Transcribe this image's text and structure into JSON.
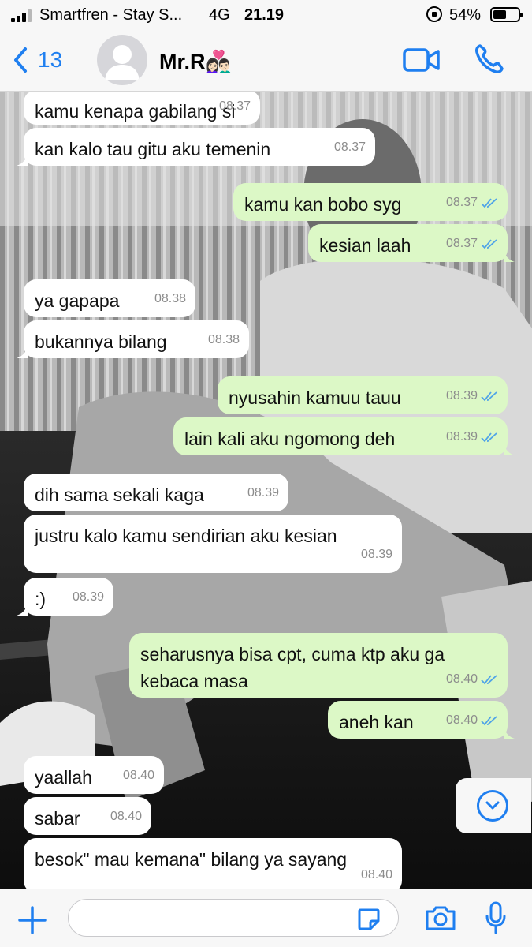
{
  "status_bar": {
    "carrier": "Smartfren - Stay S...",
    "network": "4G",
    "time": "21.19",
    "battery_percent": "54%",
    "battery_level": 0.54,
    "signal_bars": 3
  },
  "header": {
    "back_count": "13",
    "contact_name": "Mr.R👩🏻‍❤️‍👨🏻",
    "icons": [
      "chevron-left-icon",
      "video-call-icon",
      "phone-icon"
    ]
  },
  "messages": [
    {
      "dir": "in",
      "text": "kamu kenapa gabilang si",
      "time": "08.37"
    },
    {
      "dir": "in",
      "text": "kan kalo tau gitu aku temenin",
      "time": "08.37"
    },
    {
      "dir": "out",
      "text": "kamu kan bobo syg",
      "time": "08.37"
    },
    {
      "dir": "out",
      "text": "kesian laah",
      "time": "08.37"
    },
    {
      "dir": "in",
      "text": "ya gapapa",
      "time": "08.38"
    },
    {
      "dir": "in",
      "text": "bukannya bilang",
      "time": "08.38"
    },
    {
      "dir": "out",
      "text": "nyusahin kamuu tauu",
      "time": "08.39"
    },
    {
      "dir": "out",
      "text": "lain kali aku ngomong deh",
      "time": "08.39"
    },
    {
      "dir": "in",
      "text": "dih sama sekali kaga",
      "time": "08.39"
    },
    {
      "dir": "in",
      "text": "justru kalo kamu sendirian aku kesian",
      "time": "08.39"
    },
    {
      "dir": "in",
      "text": ":)",
      "time": "08.39"
    },
    {
      "dir": "out",
      "text": "seharusnya bisa cpt, cuma ktp aku ga kebaca masa",
      "time": "08.40"
    },
    {
      "dir": "out",
      "text": "aneh kan",
      "time": "08.40"
    },
    {
      "dir": "in",
      "text": "yaallah",
      "time": "08.40"
    },
    {
      "dir": "in",
      "text": "sabar",
      "time": "08.40"
    },
    {
      "dir": "in",
      "text": "besok\" mau kemana\" bilang ya sayang",
      "time": "08.40"
    }
  ],
  "input": {
    "placeholder": "",
    "icons": [
      "plus-icon",
      "sticker-icon",
      "camera-icon",
      "microphone-icon"
    ]
  },
  "colors": {
    "accent": "#1f7ff0",
    "outgoing_bubble": "#dcf8c6",
    "incoming_bubble": "#ffffff",
    "bar_background": "#f7f7f7"
  }
}
